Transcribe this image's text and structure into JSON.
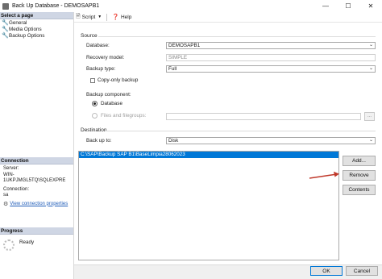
{
  "window": {
    "title": "Back Up Database - DEMOSAPB1",
    "minimize": "—",
    "maximize": "☐",
    "close": "✕"
  },
  "left": {
    "select_page_header": "Select a page",
    "pages": [
      {
        "label": "General"
      },
      {
        "label": "Media Options"
      },
      {
        "label": "Backup Options"
      }
    ],
    "connection_header": "Connection",
    "server_label": "Server:",
    "server_value": "WIN-1UKPJMGL5TQ\\SQLEXPRE",
    "connection_label": "Connection:",
    "connection_value": "sa",
    "view_connection_properties": "View connection properties",
    "progress_header": "Progress",
    "progress_status": "Ready"
  },
  "toolbar": {
    "script_label": "Script",
    "help_label": "Help"
  },
  "source": {
    "group_label": "Source",
    "database_label": "Database:",
    "database_value": "DEMOSAPB1",
    "recovery_model_label": "Recovery model:",
    "recovery_model_value": "SIMPLE",
    "backup_type_label": "Backup type:",
    "backup_type_value": "Full",
    "copy_only_label": "Copy-only backup",
    "backup_component_label": "Backup component:",
    "component_database_label": "Database",
    "component_files_label": "Files and filegroups:",
    "browse_label": "..."
  },
  "destination": {
    "group_label": "Destination",
    "back_up_to_label": "Back up to:",
    "back_up_to_value": "Disk",
    "paths": [
      "C:\\SAP\\Backup SAP B1\\BaseLimpia28062023"
    ],
    "add_label": "Add...",
    "remove_label": "Remove",
    "contents_label": "Contents"
  },
  "footer": {
    "ok_label": "OK",
    "cancel_label": "Cancel"
  },
  "colors": {
    "selection": "#0078d7",
    "annotation_arrow": "#c0392b",
    "link": "#1e5bb8"
  }
}
